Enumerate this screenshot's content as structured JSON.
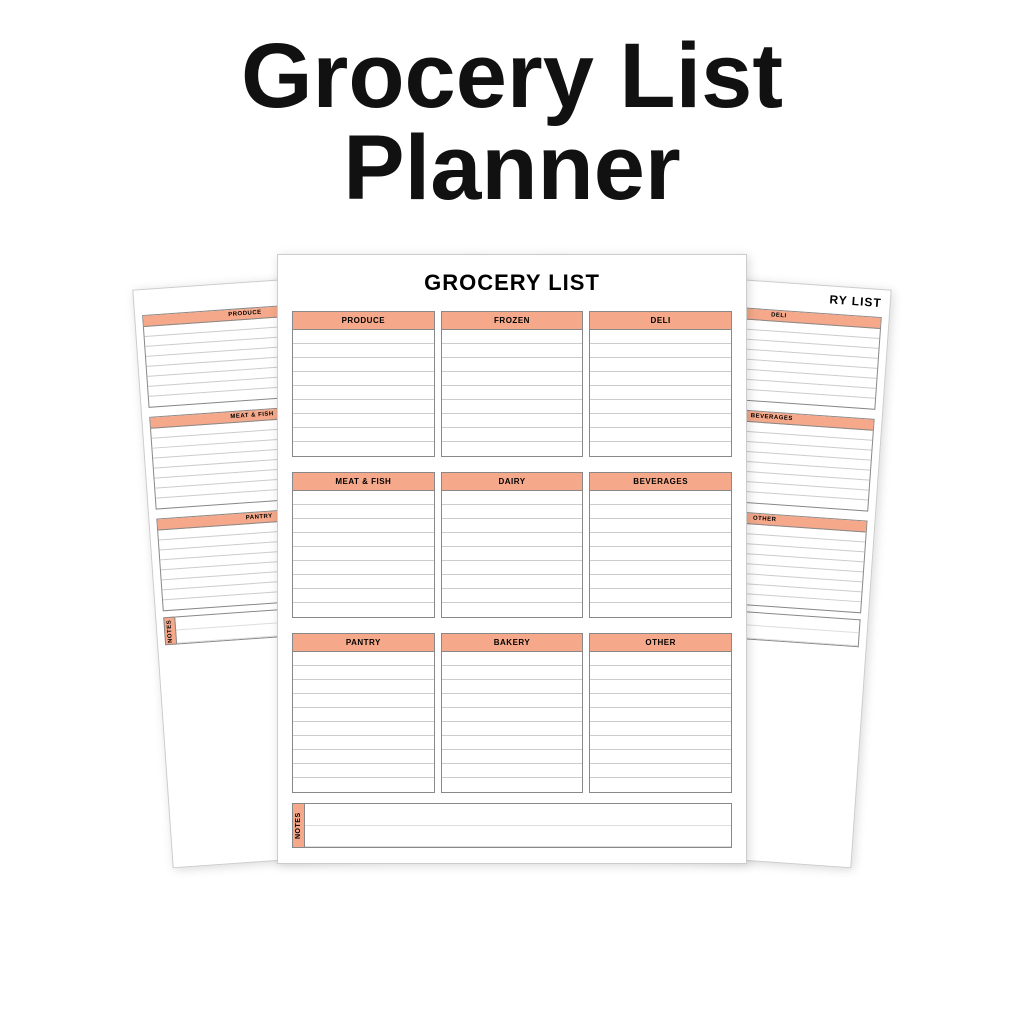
{
  "page": {
    "title_line1": "Grocery List",
    "title_line2": "Planner",
    "accent_color": "#f5a98a",
    "accent_light": "#fde8df"
  },
  "front_sheet": {
    "title": "GROCERY LIST",
    "sections": [
      {
        "label": "PRODUCE"
      },
      {
        "label": "FROZEN"
      },
      {
        "label": "DELI"
      },
      {
        "label": "MEAT & FISH"
      },
      {
        "label": "DAIRY"
      },
      {
        "label": "BEVERAGES"
      },
      {
        "label": "PANTRY"
      },
      {
        "label": "BAKERY"
      },
      {
        "label": "OTHER"
      }
    ],
    "notes_label": "NOTES"
  },
  "back_sheets": {
    "title": "GROCERY LIST",
    "left_visible": [
      "PRODUCE",
      "MEAT & FISH",
      "PANTRY"
    ],
    "right_visible": [
      "DELI",
      "BEVERAGES",
      "OTHER"
    ],
    "notes_label": "NOTES"
  }
}
